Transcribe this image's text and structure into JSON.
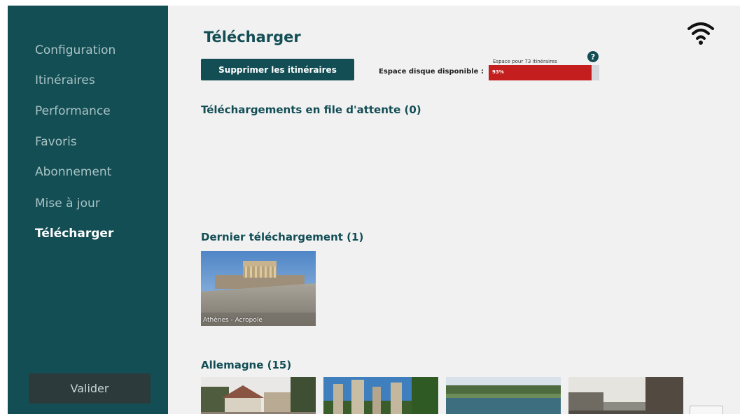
{
  "sidebar": {
    "items": [
      {
        "label": "Configuration",
        "active": false
      },
      {
        "label": "Itinéraires",
        "active": false
      },
      {
        "label": "Performance",
        "active": false
      },
      {
        "label": "Favoris",
        "active": false
      },
      {
        "label": "Abonnement",
        "active": false
      },
      {
        "label": "Mise à jour",
        "active": false
      },
      {
        "label": "Télécharger",
        "active": true
      }
    ],
    "validate_label": "Valider"
  },
  "header": {
    "title": "Télécharger",
    "delete_button": "Supprimer les itinéraires",
    "space_note": "Espace pour 73 itinéraires",
    "help_icon": "?",
    "disk_label": "Espace disque disponible :",
    "disk_percent_text": "93%",
    "disk_fill_fraction": 0.93,
    "disk_fill_color": "#c41e1e"
  },
  "queue": {
    "title": "Téléchargements en file d'attente (0)"
  },
  "latest": {
    "title": "Dernier téléchargement (1)",
    "items": [
      {
        "caption": "Athènes - Acropole"
      }
    ]
  },
  "germany": {
    "title": "Allemagne (15)"
  },
  "icons": {
    "wifi": "wifi-icon",
    "help": "help-icon"
  },
  "colors": {
    "sidebar": "#134e55",
    "accent": "#134e55",
    "background": "#f1f1f2"
  }
}
